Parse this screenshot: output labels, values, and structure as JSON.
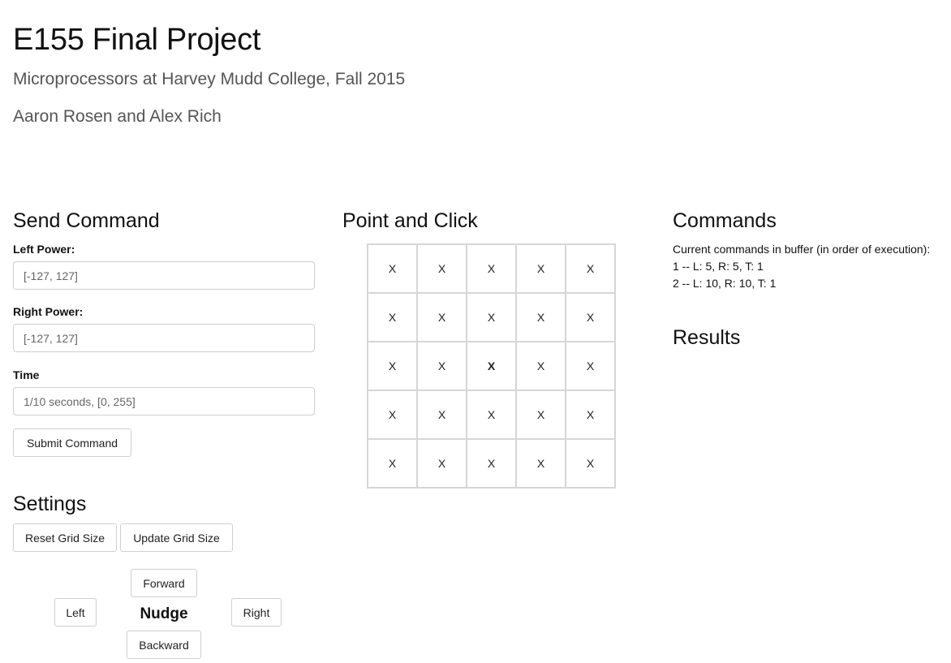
{
  "header": {
    "title": "E155 Final Project",
    "subtitle": "Microprocessors at Harvey Mudd College, Fall 2015",
    "authors": "Aaron Rosen and Alex Rich"
  },
  "send_command": {
    "heading": "Send Command",
    "left_power": {
      "label": "Left Power:",
      "placeholder": "[-127, 127]",
      "value": ""
    },
    "right_power": {
      "label": "Right Power:",
      "placeholder": "[-127, 127]",
      "value": ""
    },
    "time": {
      "label": "Time",
      "placeholder": "1/10 seconds, [0, 255]",
      "value": ""
    },
    "submit_label": "Submit Command"
  },
  "settings": {
    "heading": "Settings",
    "reset_label": "Reset Grid Size",
    "update_label": "Update Grid Size"
  },
  "nudge": {
    "label": "Nudge",
    "forward": "Forward",
    "backward": "Backward",
    "left": "Left",
    "right": "Right"
  },
  "point_and_click": {
    "heading": "Point and Click",
    "rows": [
      [
        "X",
        "X",
        "X",
        "X",
        "X"
      ],
      [
        "X",
        "X",
        "X",
        "X",
        "X"
      ],
      [
        "X",
        "X",
        "X",
        "X",
        "X"
      ],
      [
        "X",
        "X",
        "X",
        "X",
        "X"
      ],
      [
        "X",
        "X",
        "X",
        "X",
        "X"
      ]
    ],
    "active_cell": [
      2,
      2
    ]
  },
  "commands": {
    "heading": "Commands",
    "intro": "Current commands in buffer (in order of execution):",
    "items": [
      "1 -- L: 5, R: 5, T: 1",
      "2 -- L: 10, R: 10, T: 1"
    ]
  },
  "results": {
    "heading": "Results"
  }
}
